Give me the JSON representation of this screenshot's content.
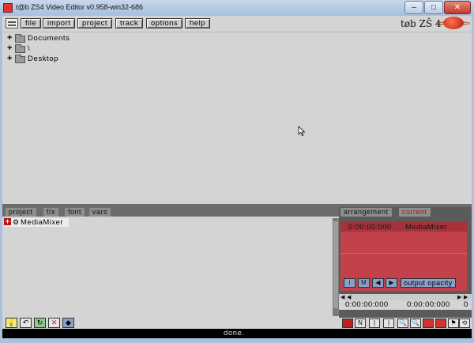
{
  "window": {
    "title": "t@b ZS4 Video Editor v0.958-win32-686",
    "buttons": {
      "minimize": "–",
      "maximize": "□",
      "close": "✕"
    }
  },
  "menu": {
    "items": [
      "file",
      "import",
      "project",
      "track",
      "options",
      "help"
    ],
    "logo_text": "tøb ZŠ 4"
  },
  "browser": {
    "items": [
      {
        "label": "Documents",
        "expander": "+"
      },
      {
        "label": "\\",
        "expander": "+"
      },
      {
        "label": "Desktop",
        "expander": "+"
      }
    ]
  },
  "lower_left": {
    "tabs": [
      "project",
      "f/x",
      "font",
      "vars"
    ],
    "tree": {
      "label": "MediaMixer",
      "expander": "+"
    }
  },
  "lower_right": {
    "tabs": [
      "arrangement",
      "current"
    ],
    "active_tab": "current",
    "header_time": "0:00:00:000",
    "header_track": "MediaMixer",
    "tools": [
      "i",
      "M"
    ],
    "opacity_button": "output opacity",
    "time_start": "0:00:00:000",
    "time_end": "0:00:00:000",
    "time_more": "0"
  },
  "status": {
    "text": "done."
  },
  "colors": {
    "accent_red": "#c2414b",
    "panel_gray": "#d4d4d4",
    "active_tab_text": "#a51a1a"
  },
  "icons": {
    "folder": "folder-icon",
    "gear": "gear-icon",
    "cursor": "mouse-pointer-icon"
  }
}
